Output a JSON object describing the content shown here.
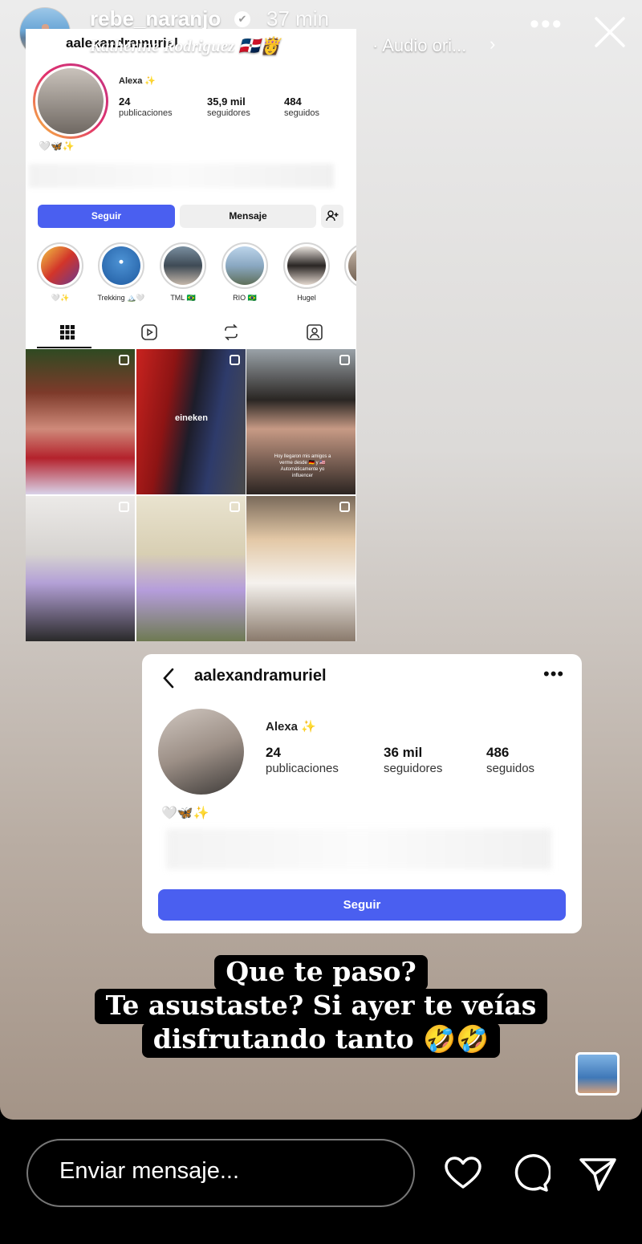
{
  "header": {
    "username": "rebe_naranjo",
    "time": "37 min",
    "music_artist": "Katherine Rodriguez 🇩🇴👸",
    "audio_label": "· Audio ori...",
    "more": "•••"
  },
  "screenshot1": {
    "username": "aalexandramuriel",
    "name": "Alexa ✨",
    "stats": [
      {
        "value": "24",
        "label": "publicaciones"
      },
      {
        "value": "35,9 mil",
        "label": "seguidores"
      },
      {
        "value": "484",
        "label": "seguidos"
      }
    ],
    "bio": "🤍🦋✨",
    "follow_button": "Seguir",
    "message_button": "Mensaje",
    "highlights": [
      "🤍✨",
      "Trekking 🏔️🤍",
      "TML 🇧🇷",
      "RIO 🇧🇷",
      "Hugel",
      ""
    ],
    "tile_caption": "Hoy llegaron mis amigos a verme desde 🇩🇪 y 🇺🇸 Automáticamente yo influencer",
    "tile_sign": "eineken"
  },
  "screenshot2": {
    "username": "aalexandramuriel",
    "name": "Alexa ✨",
    "stats": [
      {
        "value": "24",
        "label": "publicaciones"
      },
      {
        "value": "36 mil",
        "label": "seguidores"
      },
      {
        "value": "486",
        "label": "seguidos"
      }
    ],
    "bio": "🤍🦋✨",
    "follow_button": "Seguir"
  },
  "caption": {
    "line1": "Que te paso?",
    "line2": "Te asustaste? Si ayer te veías",
    "line3": "disfrutando tanto 🤣🤣"
  },
  "footer": {
    "message_placeholder": "Enviar mensaje..."
  }
}
